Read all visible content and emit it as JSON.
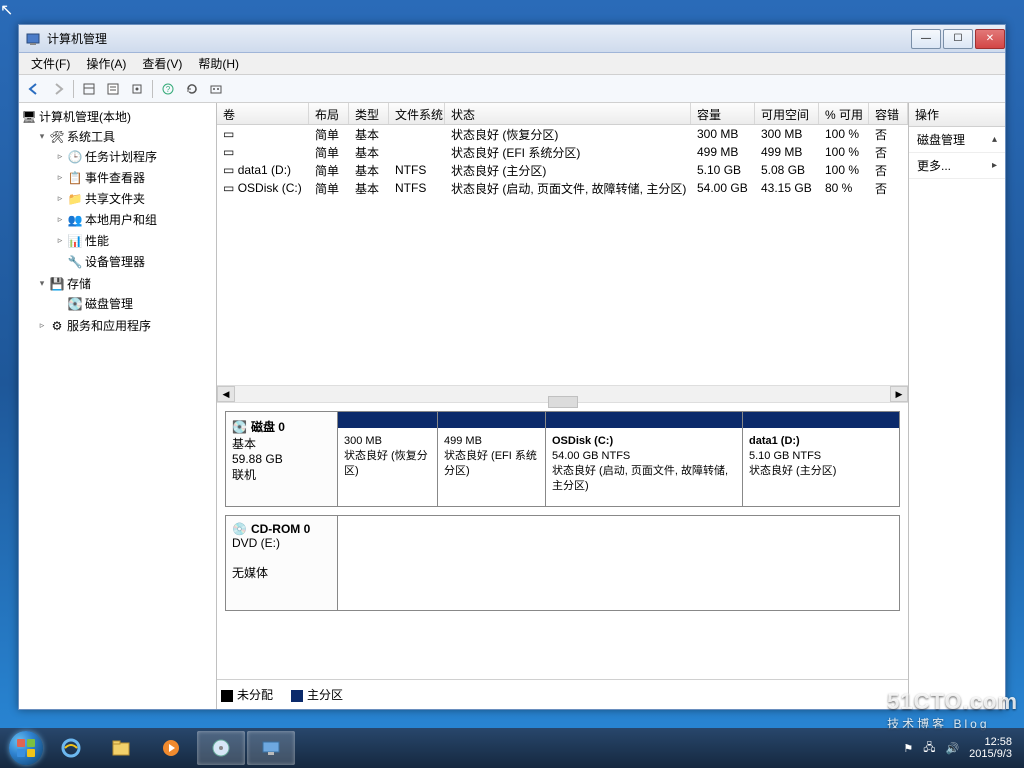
{
  "window": {
    "title": "计算机管理"
  },
  "menu": {
    "file": "文件(F)",
    "action": "操作(A)",
    "view": "查看(V)",
    "help": "帮助(H)"
  },
  "tree": {
    "root": "计算机管理(本地)",
    "systools": "系统工具",
    "scheduler": "任务计划程序",
    "eventviewer": "事件查看器",
    "shares": "共享文件夹",
    "users": "本地用户和组",
    "perf": "性能",
    "devmgr": "设备管理器",
    "storage": "存储",
    "diskmgmt": "磁盘管理",
    "services": "服务和应用程序"
  },
  "cols": {
    "volume": "卷",
    "layout": "布局",
    "type": "类型",
    "fs": "文件系统",
    "status": "状态",
    "capacity": "容量",
    "free": "可用空间",
    "pctfree": "% 可用",
    "fault": "容错"
  },
  "vols": [
    {
      "name": "",
      "layout": "简单",
      "type": "基本",
      "fs": "",
      "status": "状态良好 (恢复分区)",
      "cap": "300 MB",
      "free": "300 MB",
      "pct": "100 %",
      "fault": "否"
    },
    {
      "name": "",
      "layout": "简单",
      "type": "基本",
      "fs": "",
      "status": "状态良好 (EFI 系统分区)",
      "cap": "499 MB",
      "free": "499 MB",
      "pct": "100 %",
      "fault": "否"
    },
    {
      "name": "data1 (D:)",
      "layout": "简单",
      "type": "基本",
      "fs": "NTFS",
      "status": "状态良好 (主分区)",
      "cap": "5.10 GB",
      "free": "5.08 GB",
      "pct": "100 %",
      "fault": "否"
    },
    {
      "name": "OSDisk (C:)",
      "layout": "简单",
      "type": "基本",
      "fs": "NTFS",
      "status": "状态良好 (启动, 页面文件, 故障转储, 主分区)",
      "cap": "54.00 GB",
      "free": "43.15 GB",
      "pct": "80 %",
      "fault": "否"
    }
  ],
  "disk0": {
    "title": "磁盘 0",
    "type": "基本",
    "size": "59.88 GB",
    "state": "联机",
    "parts": [
      {
        "title": "",
        "size": "300 MB",
        "status": "状态良好 (恢复分区)"
      },
      {
        "title": "",
        "size": "499 MB",
        "status": "状态良好 (EFI 系统分区)"
      },
      {
        "title": "OSDisk  (C:)",
        "size": "54.00 GB NTFS",
        "status": "状态良好 (启动, 页面文件, 故障转储, 主分区)"
      },
      {
        "title": "data1  (D:)",
        "size": "5.10 GB NTFS",
        "status": "状态良好 (主分区)"
      }
    ]
  },
  "cdrom": {
    "title": "CD-ROM 0",
    "type": "DVD (E:)",
    "state": "无媒体"
  },
  "legend": {
    "unalloc": "未分配",
    "primary": "主分区"
  },
  "actions": {
    "header": "操作",
    "disk": "磁盘管理",
    "more": "更多..."
  },
  "tray": {
    "time": "12:58",
    "date": "2015/9/3"
  },
  "watermark": {
    "main": "51CTO.com",
    "sub": "技术博客 Blog"
  }
}
